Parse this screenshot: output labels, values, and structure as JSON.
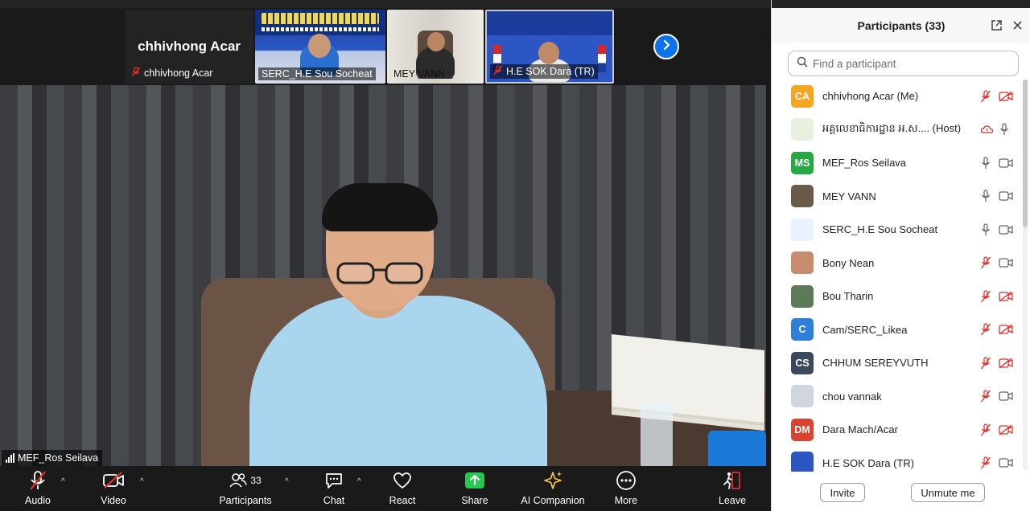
{
  "filmstrip": {
    "self_name_big": "chhivhong Acar",
    "tiles": [
      {
        "label": "chhivhong Acar"
      },
      {
        "label": "SERC_H.E Sou Socheat"
      },
      {
        "label": "MEY VANN"
      },
      {
        "label": "H.E SOK Dara (TR)"
      }
    ]
  },
  "main_video": {
    "speaker_label": "MEF_Ros Seilava"
  },
  "toolbar": {
    "audio": "Audio",
    "video": "Video",
    "participants": "Participants",
    "participants_count": "33",
    "chat": "Chat",
    "react": "React",
    "share": "Share",
    "ai_companion": "AI Companion",
    "more": "More",
    "leave": "Leave"
  },
  "panel": {
    "title": "Participants (33)",
    "search_placeholder": "Find a participant",
    "invite": "Invite",
    "unmute_me": "Unmute me",
    "participants": [
      {
        "initials": "CA",
        "name": "chhivhong Acar (Me)",
        "avatar_color": "#f5a623",
        "mic": "muted",
        "cam": "off"
      },
      {
        "initials": "",
        "name": "អគ្គលេខាធិការដ្ឋាន អ.ស.... (Host)",
        "avatar_color": "#e8f0df",
        "mic": "on",
        "cam": "cloud"
      },
      {
        "initials": "MS",
        "name": "MEF_Ros Seilava",
        "avatar_color": "#27a844",
        "mic": "on",
        "cam": "on"
      },
      {
        "initials": "",
        "name": "MEY VANN",
        "avatar_color": "#6b5a4a",
        "mic": "on",
        "cam": "on"
      },
      {
        "initials": "",
        "name": "SERC_H.E Sou Socheat",
        "avatar_color": "#e9f1ff",
        "mic": "on",
        "cam": "on"
      },
      {
        "initials": "",
        "name": "Bony Nean",
        "avatar_color": "#c98b6e",
        "mic": "muted",
        "cam": "on"
      },
      {
        "initials": "",
        "name": "Bou Tharin",
        "avatar_color": "#5d7a58",
        "mic": "muted",
        "cam": "off"
      },
      {
        "initials": "C",
        "name": "Cam/SERC_Likea",
        "avatar_color": "#2f7fd8",
        "mic": "muted",
        "cam": "off"
      },
      {
        "initials": "CS",
        "name": "CHHUM SEREYVUTH",
        "avatar_color": "#3a4a5c",
        "mic": "muted",
        "cam": "off"
      },
      {
        "initials": "",
        "name": "chou vannak",
        "avatar_color": "#cfd6de",
        "mic": "muted",
        "cam": "on"
      },
      {
        "initials": "DM",
        "name": "Dara Mach/Acar",
        "avatar_color": "#d9432f",
        "mic": "muted",
        "cam": "off"
      },
      {
        "initials": "",
        "name": "H.E SOK Dara (TR)",
        "avatar_color": "#2d56c5",
        "mic": "muted",
        "cam": "on"
      }
    ]
  },
  "colors": {
    "accent": "#0e72ed",
    "muted_red": "#e0312b",
    "share_green": "#26c94f",
    "ai_gold": "#f5c542"
  }
}
